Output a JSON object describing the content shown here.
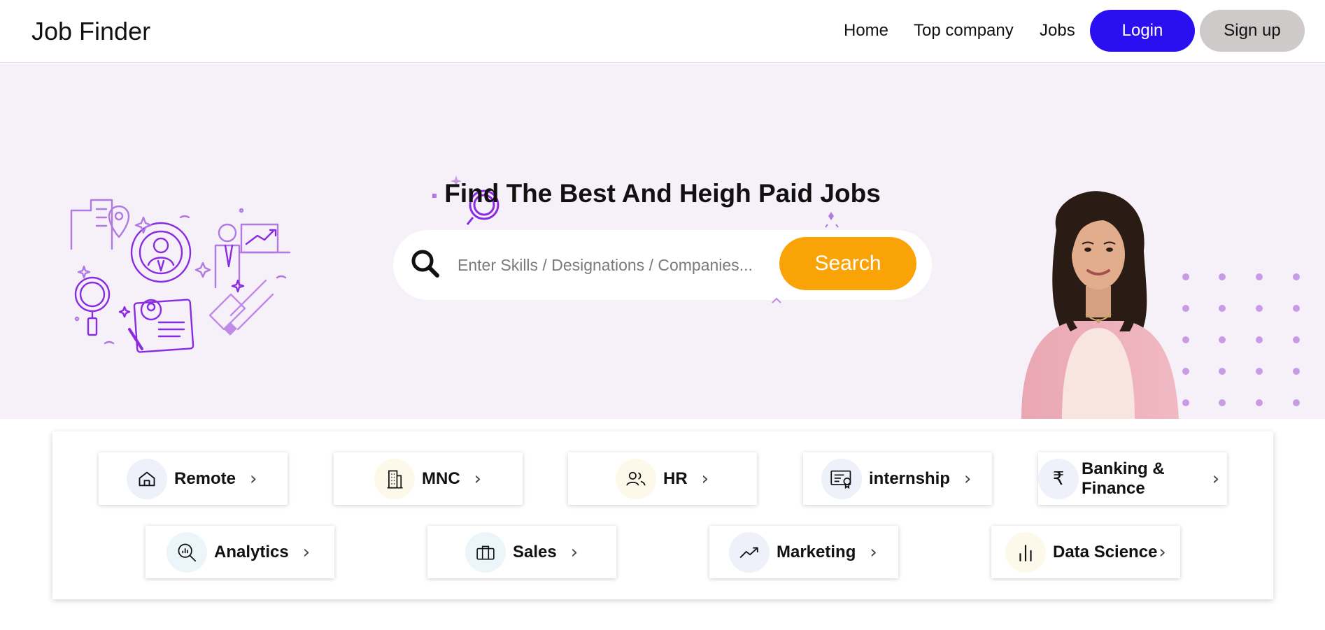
{
  "nav": {
    "brand": "Job Finder",
    "links": [
      "Home",
      "Top company",
      "Jobs"
    ],
    "login_label": "Login",
    "signup_label": "Sign up"
  },
  "hero": {
    "title": "Find The Best And Heigh Paid Jobs",
    "search_placeholder": "Enter Skills / Designations / Companies...",
    "search_button": "Search"
  },
  "categories": {
    "row1": [
      {
        "label": "Remote",
        "icon": "home-icon"
      },
      {
        "label": "MNC",
        "icon": "building-icon"
      },
      {
        "label": "HR",
        "icon": "users-icon"
      },
      {
        "label": "internship",
        "icon": "certificate-icon"
      },
      {
        "label_line1": "Banking &",
        "label_line2": "Finance",
        "icon": "rupee-icon"
      }
    ],
    "row2": [
      {
        "label": "Analytics",
        "icon": "analytics-icon"
      },
      {
        "label": "Sales",
        "icon": "briefcase-icon"
      },
      {
        "label": "Marketing",
        "icon": "trend-up-icon"
      },
      {
        "label": "Data Science",
        "icon": "bar-chart-icon"
      }
    ]
  },
  "colors": {
    "primary": "#2a0ff0",
    "search_button": "#faa307",
    "hero_bg": "#f6f0f8",
    "accent_purple": "#8a2be2"
  }
}
